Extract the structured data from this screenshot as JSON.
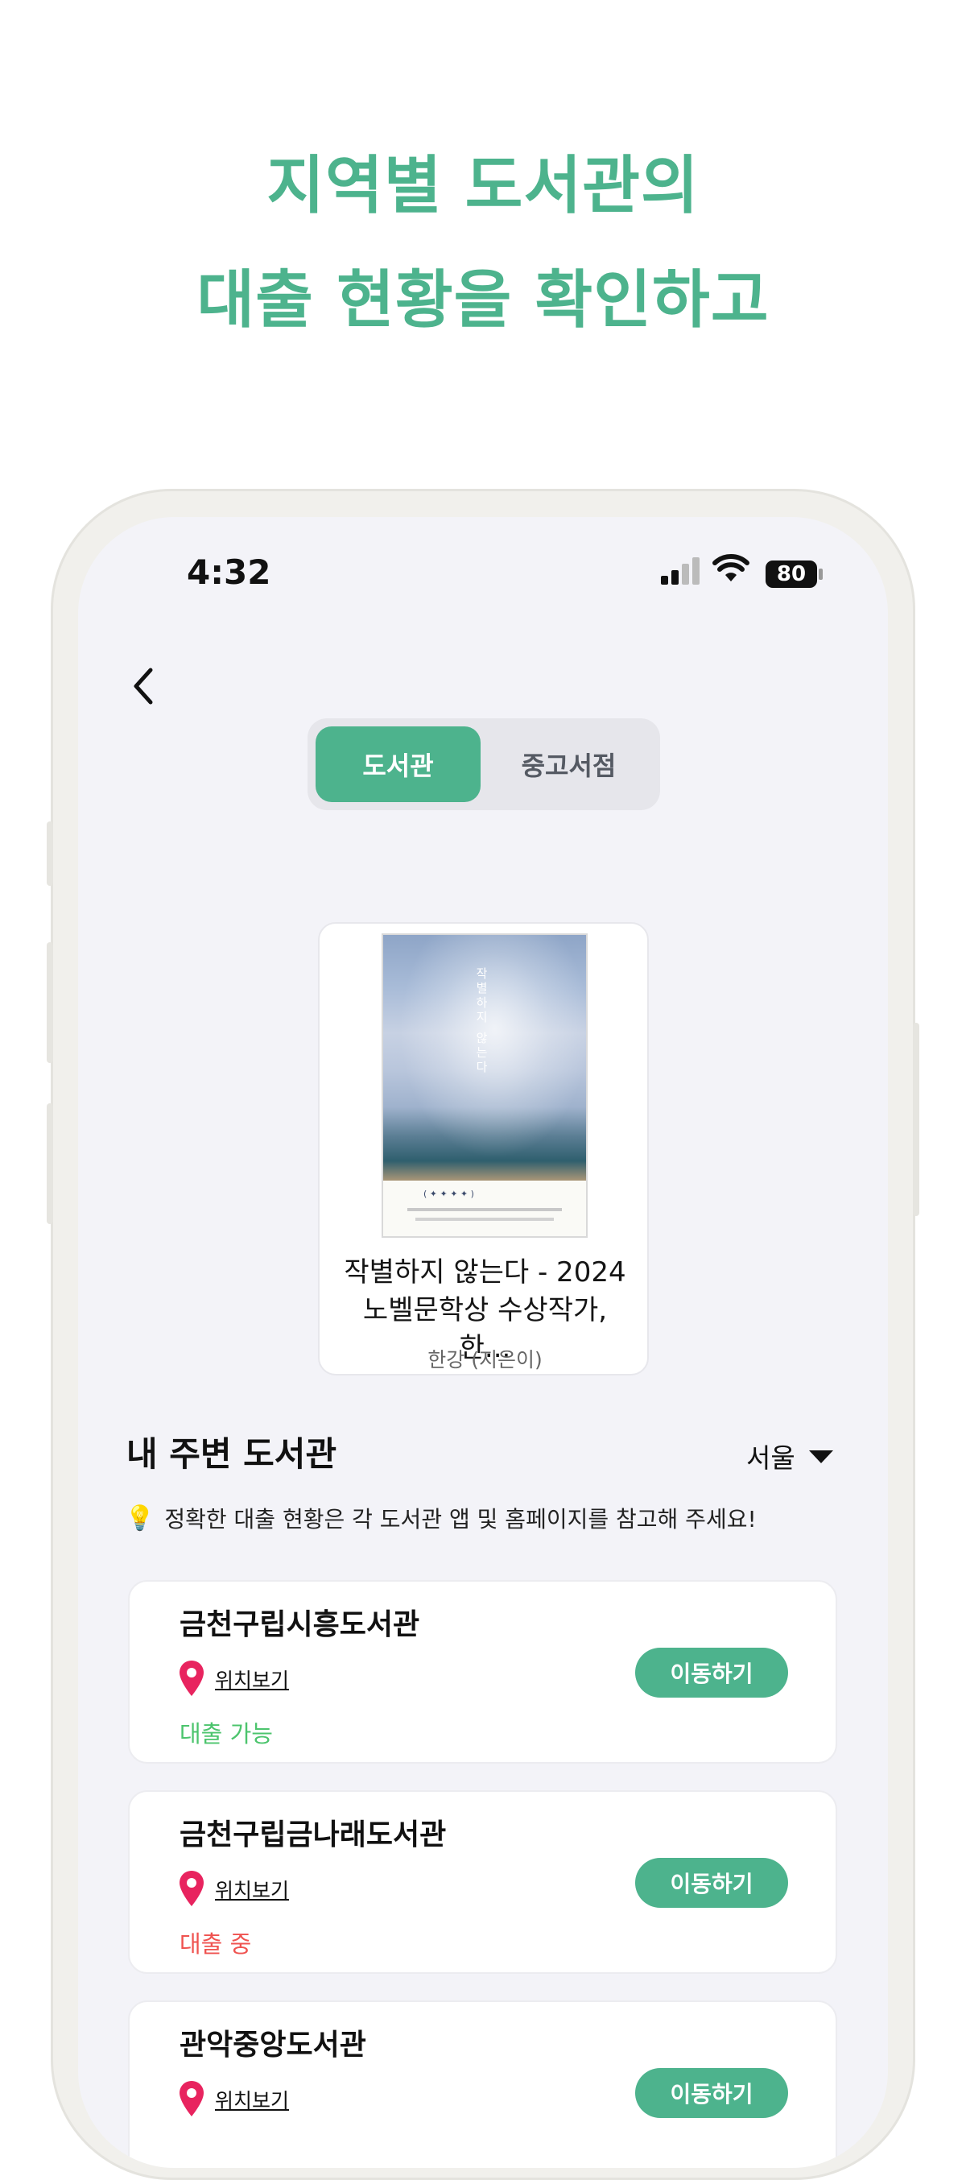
{
  "headline": {
    "line1": "지역별 도서관의",
    "line2": "대출 현황을 확인하고"
  },
  "status_bar": {
    "time": "4:32",
    "battery": "80"
  },
  "tabs": {
    "active": "도서관",
    "inactive": "중고서점"
  },
  "book": {
    "title": "작별하지 않는다 - 2024 노벨문학상 수상작가, 한...",
    "author": "한강 (지은이)",
    "cover_title": "작별하지 않는다"
  },
  "section": {
    "title": "내 주변 도서관",
    "region": "서울",
    "notice": "정확한 대출 현황은 각 도서관 앱 및 홈페이지를 참고해 주세요!"
  },
  "libraries": [
    {
      "name": "금천구립시흥도서관",
      "location_label": "위치보기",
      "status": "대출 가능",
      "status_color": "#4cc46d",
      "action": "이동하기"
    },
    {
      "name": "금천구립금나래도서관",
      "location_label": "위치보기",
      "status": "대출 중",
      "status_color": "#ef5350",
      "action": "이동하기"
    },
    {
      "name": "관악중앙도서관",
      "location_label": "위치보기",
      "status": "",
      "status_color": "#4cc46d",
      "action": "이동하기"
    }
  ],
  "colors": {
    "accent": "#4db38d",
    "pin": "#e8245f",
    "available": "#4cc46d",
    "on_loan": "#ef5350"
  }
}
